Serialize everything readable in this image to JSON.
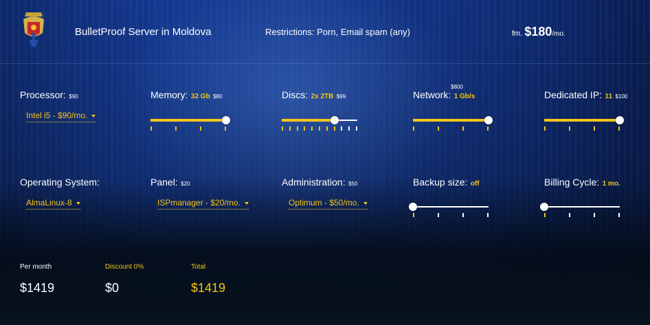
{
  "header": {
    "title": "BulletProof Server in Moldova",
    "restrictions": "Restrictions: Porn, Email spam (any)",
    "price_prefix": "fm.",
    "price": "$180",
    "price_suffix": "/mo."
  },
  "config": {
    "processor": {
      "label": "Processor:",
      "price": "$90",
      "selected": "Intel i5 - $90/mo."
    },
    "memory": {
      "label": "Memory:",
      "value": "32 Gb",
      "price": "$80",
      "level": 1.0,
      "ticks": 4
    },
    "discs": {
      "label": "Discs:",
      "value": "2x 2TB",
      "price": "$99",
      "level": 0.7,
      "ticks": 11
    },
    "network": {
      "label": "Network:",
      "value": "1 Gb/s",
      "price": "$800",
      "level": 1.0,
      "ticks": 4
    },
    "dedicated_ip": {
      "label": "Dedicated IP:",
      "value": "11",
      "price": "$100",
      "level": 1.0,
      "ticks": 4
    },
    "os": {
      "label": "Operating System:",
      "selected": "AlmaLinux-8"
    },
    "panel": {
      "label": "Panel:",
      "price": "$20",
      "selected": "ISPmanager - $20/mo."
    },
    "administration": {
      "label": "Administration:",
      "price": "$50",
      "selected": "Optimum - $50/mo."
    },
    "backup": {
      "label": "Backup size:",
      "value": "off",
      "level": 0.0,
      "ticks": 4
    },
    "billing": {
      "label": "Billing Cycle:",
      "value": "1 mo.",
      "level": 0.0,
      "ticks": 4
    }
  },
  "summary": {
    "per_month_label": "Per month",
    "per_month_value": "$1419",
    "discount_label": "Discount 0%",
    "discount_value": "$0",
    "total_label": "Total",
    "total_value": "$1419"
  },
  "colors": {
    "accent": "#f5c518",
    "text": "#ffffff"
  }
}
